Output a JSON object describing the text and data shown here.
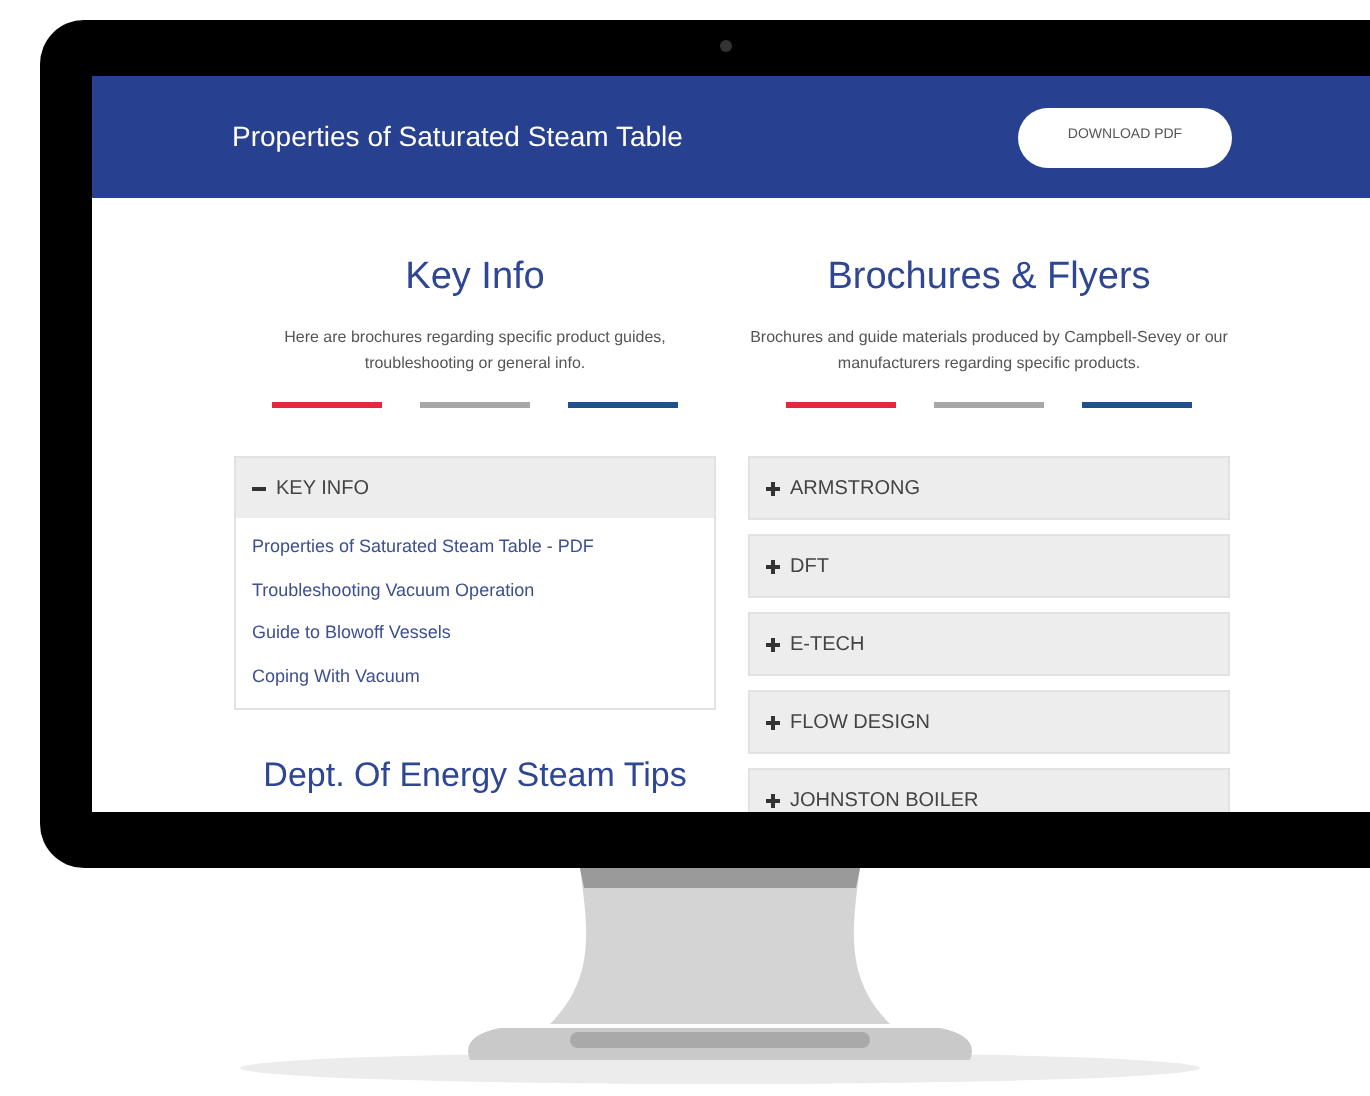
{
  "header": {
    "title": "Properties of Saturated Steam Table",
    "button": "DOWNLOAD PDF"
  },
  "left": {
    "heading": "Key Info",
    "description": "Here are brochures regarding specific product guides, troubleshooting or general info.",
    "accordion": [
      {
        "label": "KEY INFO",
        "expanded": true,
        "links": [
          "Properties of Saturated Steam Table - PDF",
          "Troubleshooting Vacuum Operation",
          "Guide to Blowoff Vessels",
          "Coping With Vacuum"
        ]
      }
    ],
    "next_heading": "Dept. Of Energy Steam Tips"
  },
  "right": {
    "heading": "Brochures & Flyers",
    "description": "Brochures and guide materials produced by Campbell-Sevey or our manufacturers regarding specific products.",
    "accordion": [
      {
        "label": "ARMSTRONG",
        "expanded": false
      },
      {
        "label": "DFT",
        "expanded": false
      },
      {
        "label": "E-TECH",
        "expanded": false
      },
      {
        "label": "FLOW DESIGN",
        "expanded": false
      },
      {
        "label": "JOHNSTON BOILER",
        "expanded": false
      }
    ]
  }
}
